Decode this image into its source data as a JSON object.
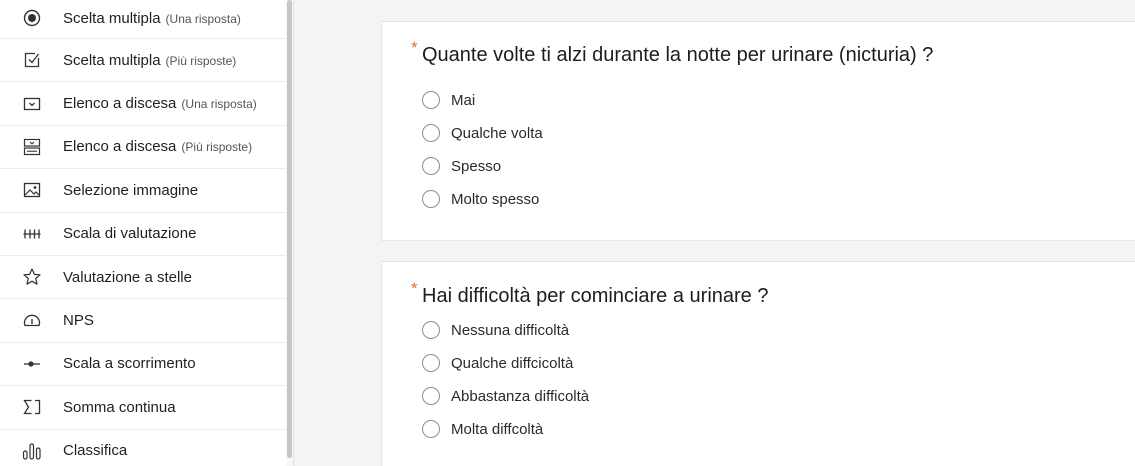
{
  "sidebar": {
    "items": [
      {
        "icon": "radio-button-icon",
        "label": "Scelta multipla",
        "sub": "(Una risposta)"
      },
      {
        "icon": "checkbox-icon",
        "label": "Scelta multipla",
        "sub": "(Più risposte)"
      },
      {
        "icon": "dropdown-icon",
        "label": "Elenco a discesa",
        "sub": "(Una risposta)"
      },
      {
        "icon": "multi-dropdown-icon",
        "label": "Elenco a discesa",
        "sub": "(Più risposte)"
      },
      {
        "icon": "image-icon",
        "label": "Selezione immagine",
        "sub": ""
      },
      {
        "icon": "rating-scale-icon",
        "label": "Scala di valutazione",
        "sub": ""
      },
      {
        "icon": "star-icon",
        "label": "Valutazione a stelle",
        "sub": ""
      },
      {
        "icon": "gauge-icon",
        "label": "NPS",
        "sub": ""
      },
      {
        "icon": "slider-icon",
        "label": "Scala a scorrimento",
        "sub": ""
      },
      {
        "icon": "sum-icon",
        "label": "Somma continua",
        "sub": ""
      },
      {
        "icon": "ranking-icon",
        "label": "Classifica",
        "sub": ""
      }
    ]
  },
  "questions": [
    {
      "required_mark": "*",
      "title": "Quante volte ti alzi durante la notte per urinare (nicturia) ?",
      "options": [
        "Mai",
        "Qualche volta",
        "Spesso",
        "Molto spesso"
      ]
    },
    {
      "required_mark": "*",
      "title": "Hai difficoltà per cominciare a urinare ?",
      "options": [
        "Nessuna difficoltà",
        "Qualche diffcicoltà",
        "Abbastanza difficoltà",
        "Molta diffcoltà"
      ]
    }
  ],
  "colors": {
    "required": "#e0722b",
    "background": "#f4f4f4",
    "card": "#ffffff"
  }
}
